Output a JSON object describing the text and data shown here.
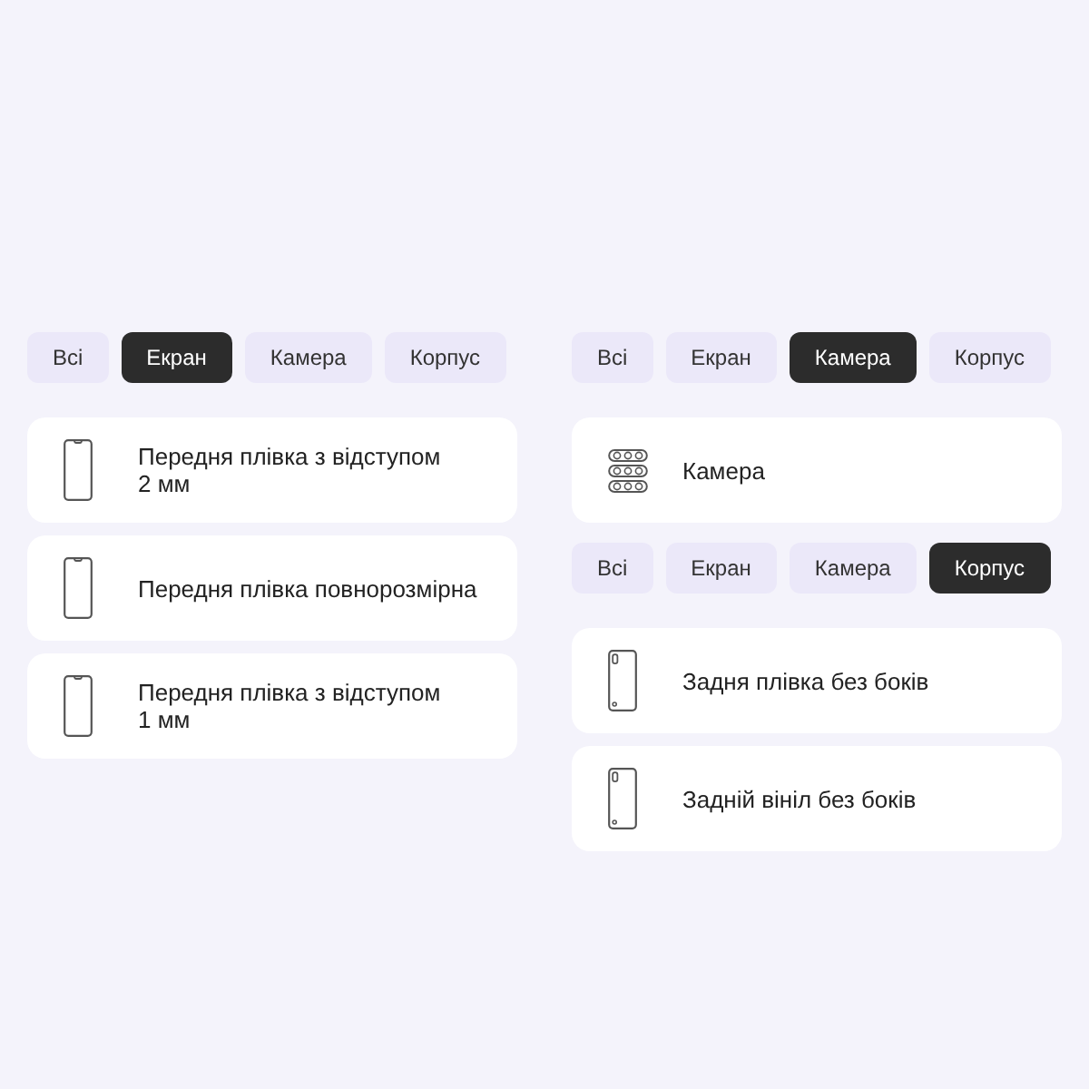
{
  "columns": [
    {
      "panels": [
        {
          "tabs": [
            {
              "label": "Всі",
              "selected": false
            },
            {
              "label": "Екран",
              "selected": true
            },
            {
              "label": "Камера",
              "selected": false
            },
            {
              "label": "Корпус",
              "selected": false
            }
          ],
          "items": [
            {
              "kind": "front",
              "label": "Передня плівка з відступом 2 мм"
            },
            {
              "kind": "front",
              "label": "Передня плівка повнорозмірна"
            },
            {
              "kind": "front",
              "label": "Передня плівка з відступом 1 мм"
            }
          ]
        }
      ]
    },
    {
      "panels": [
        {
          "tabs": [
            {
              "label": "Всі",
              "selected": false
            },
            {
              "label": "Екран",
              "selected": false
            },
            {
              "label": "Камера",
              "selected": true
            },
            {
              "label": "Корпус",
              "selected": false
            }
          ],
          "items": [
            {
              "kind": "camera",
              "label": "Камера"
            }
          ]
        },
        {
          "tabs": [
            {
              "label": "Всі",
              "selected": false
            },
            {
              "label": "Екран",
              "selected": false
            },
            {
              "label": "Камера",
              "selected": false
            },
            {
              "label": "Корпус",
              "selected": true
            }
          ],
          "items": [
            {
              "kind": "back",
              "label": "Задня плівка без боків"
            },
            {
              "kind": "back",
              "label": "Задній вініл без боків"
            }
          ]
        }
      ]
    }
  ]
}
